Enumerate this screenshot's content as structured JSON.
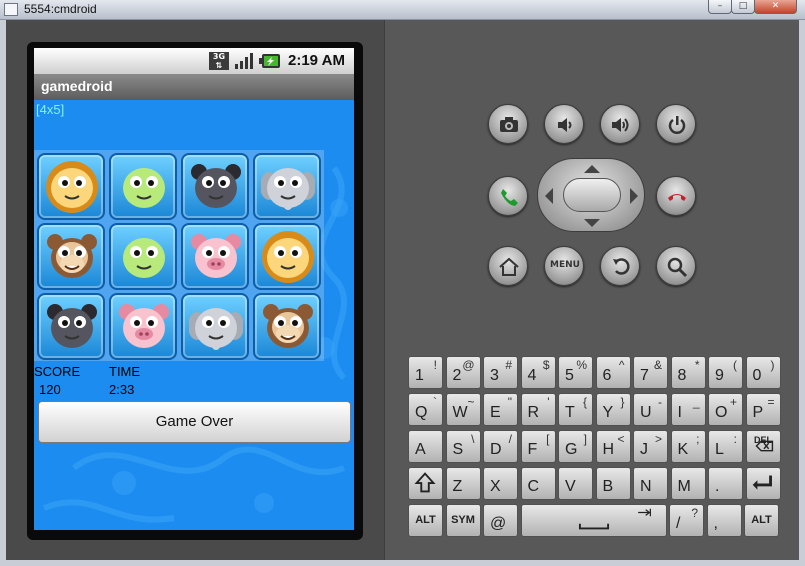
{
  "window": {
    "title": "5554:cmdroid"
  },
  "status_bar": {
    "network": "3G",
    "time": "2:19 AM"
  },
  "app": {
    "title": "gamedroid",
    "grid_size": "[4x5]",
    "tiles": [
      [
        "lion",
        "frog",
        "bear",
        "elephant"
      ],
      [
        "monkey",
        "frog",
        "pig",
        "lion"
      ],
      [
        "bear",
        "pig",
        "elephant",
        "monkey"
      ]
    ],
    "score_label": "SCORE",
    "score_value": "120",
    "time_label": "TIME",
    "time_value": "2:33",
    "game_over_label": "Game Over"
  },
  "controls": {
    "menu_label": "MENU",
    "icons": [
      "camera-icon",
      "volume-down-icon",
      "volume-up-icon",
      "power-icon",
      "call-icon",
      "end-call-icon",
      "home-icon",
      "menu-icon",
      "back-icon",
      "search-icon"
    ]
  },
  "keyboard": {
    "rows": [
      [
        {
          "m": "1",
          "a": "!"
        },
        {
          "m": "2",
          "a": "@"
        },
        {
          "m": "3",
          "a": "#"
        },
        {
          "m": "4",
          "a": "$"
        },
        {
          "m": "5",
          "a": "%"
        },
        {
          "m": "6",
          "a": "^"
        },
        {
          "m": "7",
          "a": "&"
        },
        {
          "m": "8",
          "a": "*"
        },
        {
          "m": "9",
          "a": "("
        },
        {
          "m": "0",
          "a": ")"
        }
      ],
      [
        {
          "m": "Q",
          "a": "`"
        },
        {
          "m": "W",
          "a": "~"
        },
        {
          "m": "E",
          "a": "\""
        },
        {
          "m": "R",
          "a": "'"
        },
        {
          "m": "T",
          "a": "{"
        },
        {
          "m": "Y",
          "a": "}"
        },
        {
          "m": "U",
          "a": "-"
        },
        {
          "m": "I",
          "a": "_"
        },
        {
          "m": "O",
          "a": "+"
        },
        {
          "m": "P",
          "a": "="
        }
      ],
      [
        {
          "m": "A",
          "a": ""
        },
        {
          "m": "S",
          "a": "\\"
        },
        {
          "m": "D",
          "a": "/"
        },
        {
          "m": "F",
          "a": "["
        },
        {
          "m": "G",
          "a": "]"
        },
        {
          "m": "H",
          "a": "<"
        },
        {
          "m": "J",
          "a": ">"
        },
        {
          "m": "K",
          "a": ";"
        },
        {
          "m": "L",
          "a": ":"
        },
        {
          "m": "DEL",
          "a": ""
        }
      ],
      [
        {
          "m": "SHIFT",
          "a": ""
        },
        {
          "m": "Z",
          "a": ""
        },
        {
          "m": "X",
          "a": ""
        },
        {
          "m": "C",
          "a": ""
        },
        {
          "m": "V",
          "a": ""
        },
        {
          "m": "B",
          "a": ""
        },
        {
          "m": "N",
          "a": ""
        },
        {
          "m": "M",
          "a": ""
        },
        {
          "m": ".",
          "a": ""
        },
        {
          "m": "ENTER",
          "a": ""
        }
      ]
    ],
    "bottom_row": {
      "alt_left": "ALT",
      "sym": "SYM",
      "at": "@",
      "slash_main": "/",
      "slash_alt": "?",
      "comma": ",",
      "alt_right": "ALT"
    }
  }
}
